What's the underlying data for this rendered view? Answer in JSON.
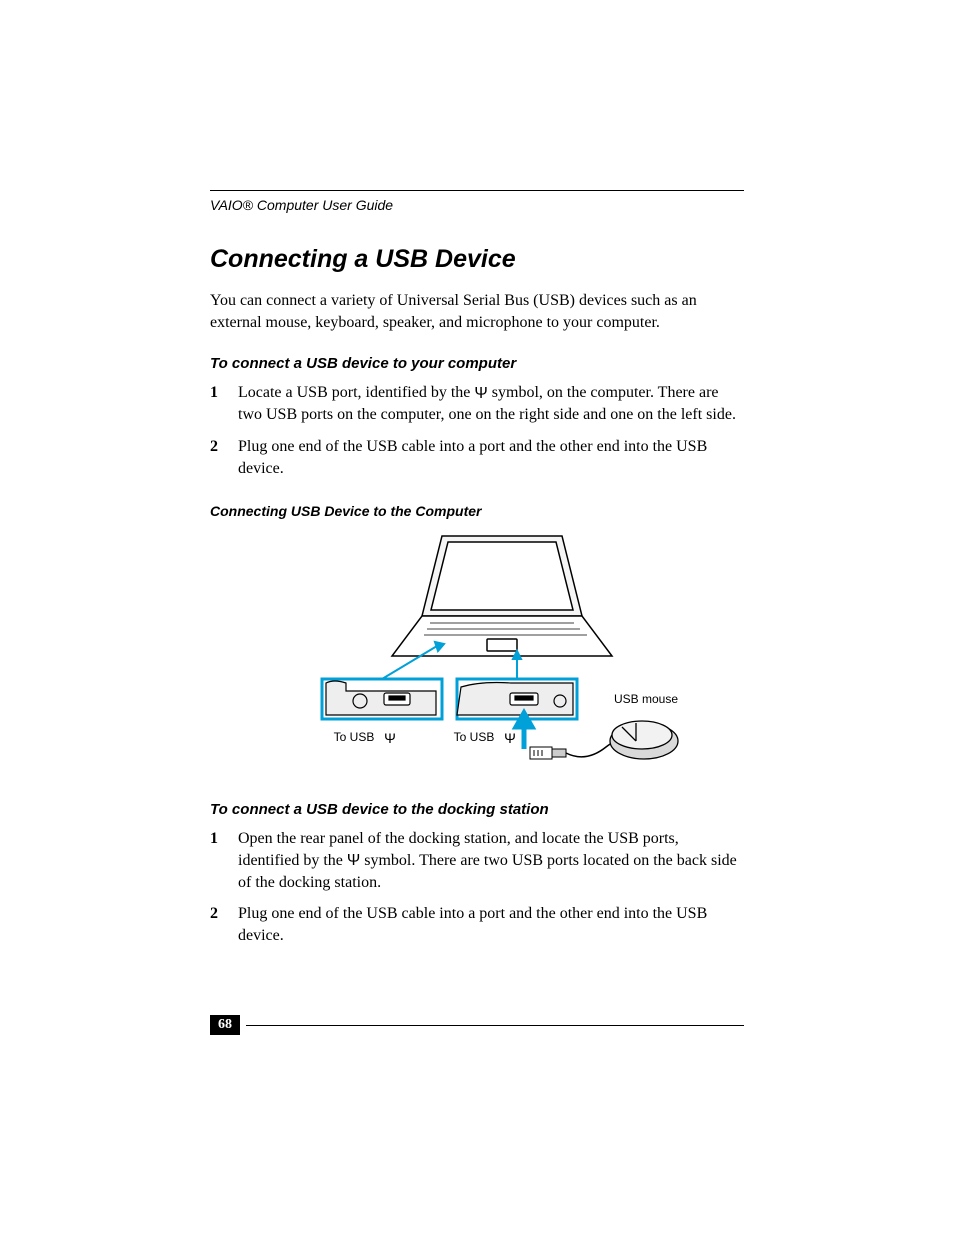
{
  "header": "VAIO® Computer User Guide",
  "title": "Connecting a USB Device",
  "intro": "You can connect a variety of Universal Serial Bus (USB) devices such as an external mouse, keyboard, speaker, and microphone to your computer.",
  "section1": {
    "heading": "To connect a USB device to your computer",
    "step1_a": "Locate a USB port, identified by the ",
    "step1_b": " symbol, on the computer. There are two USB ports on the computer, one on the right side and one on the left side.",
    "step2": "Plug one end of the USB cable into a port and the other end into the USB device."
  },
  "figure": {
    "caption": "Connecting USB Device to the Computer",
    "label_usb_mouse": "USB mouse",
    "label_to_usb_left": "To USB",
    "label_to_usb_right": "To USB"
  },
  "section2": {
    "heading": "To connect a USB device to the docking station",
    "step1_a": "Open the rear panel of the docking station, and locate the USB ports, identified by the ",
    "step1_b": " symbol. There are two USB ports located on the back side of the docking station.",
    "step2": "Plug one end of the USB cable into a port and the other end into the USB device."
  },
  "page_number": "68",
  "usb_symbol": "Ψ"
}
